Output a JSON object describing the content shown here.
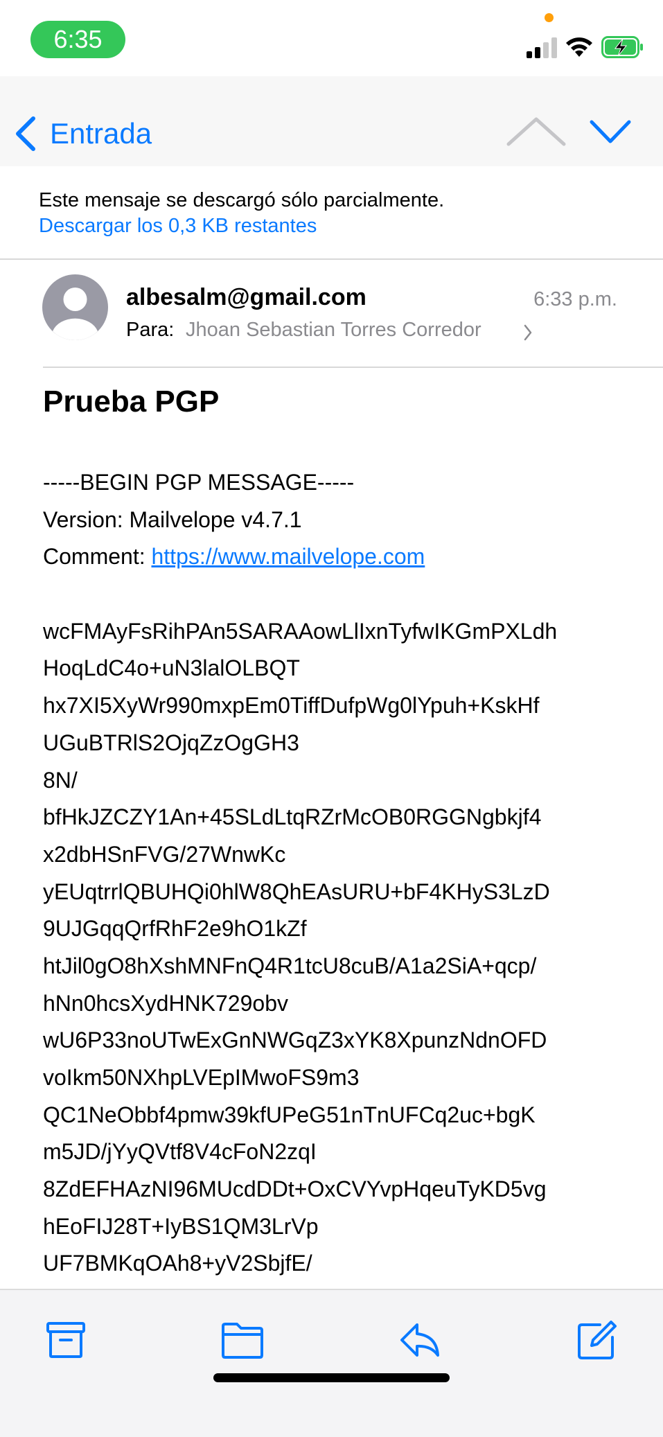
{
  "status_bar": {
    "time": "6:35"
  },
  "nav": {
    "back_label": "Entrada"
  },
  "banner": {
    "message": "Este mensaje se descargó sólo parcialmente.",
    "download_link": "Descargar los 0,3 KB restantes"
  },
  "header": {
    "sender": "albesalm@gmail.com",
    "time": "6:33 p.m.",
    "to_label": "Para:",
    "to_name": "Jhoan Sebastian Torres Corredor"
  },
  "subject": "Prueba PGP",
  "body": {
    "begin": "-----BEGIN PGP MESSAGE-----",
    "version": "Version: Mailvelope v4.7.1",
    "comment_label": "Comment: ",
    "comment_link": "https://www.mailvelope.com",
    "lines": [
      "wcFMAyFsRihPAn5SARAAowLlIxnTyfwIKGmPXLdh",
      "HoqLdC4o+uN3lalOLBQT",
      "hx7XI5XyWr990mxpEm0TiffDufpWg0lYpuh+KskHf",
      "UGuBTRlS2OjqZzOgGH3",
      "8N/",
      "bfHkJZCZY1An+45SLdLtqRZrMcOB0RGGNgbkjf4",
      "x2dbHSnFVG/27WnwKc",
      "yEUqtrrlQBUHQi0hlW8QhEAsURU+bF4KHyS3LzD",
      "9UJGqqQrfRhF2e9hO1kZf",
      "htJil0gO8hXshMNFnQ4R1tcU8cuB/A1a2SiA+qcp/",
      "hNn0hcsXydHNK729obv",
      "wU6P33noUTwExGnNWGqZ3xYK8XpunzNdnOFD",
      "voIkm50NXhpLVEpIMwoFS9m3",
      "QC1NeObbf4pmw39kfUPeG51nTnUFCq2uc+bgK",
      "m5JD/jYyQVtf8V4cFoN2zqI",
      "8ZdEFHAzNI96MUcdDDt+OxCVYvpHqeuTyKD5vg",
      "hEoFIJ28T+IyBS1QM3LrVp",
      "UF7BMKqOAh8+yV2SbjfE/"
    ]
  },
  "toolbar": {
    "icons": [
      "archive-icon",
      "folder-icon",
      "reply-icon",
      "compose-icon"
    ]
  },
  "colors": {
    "accent": "#0a7aff",
    "time_pill": "#34c759",
    "secondary_text": "#8a8a8e"
  }
}
